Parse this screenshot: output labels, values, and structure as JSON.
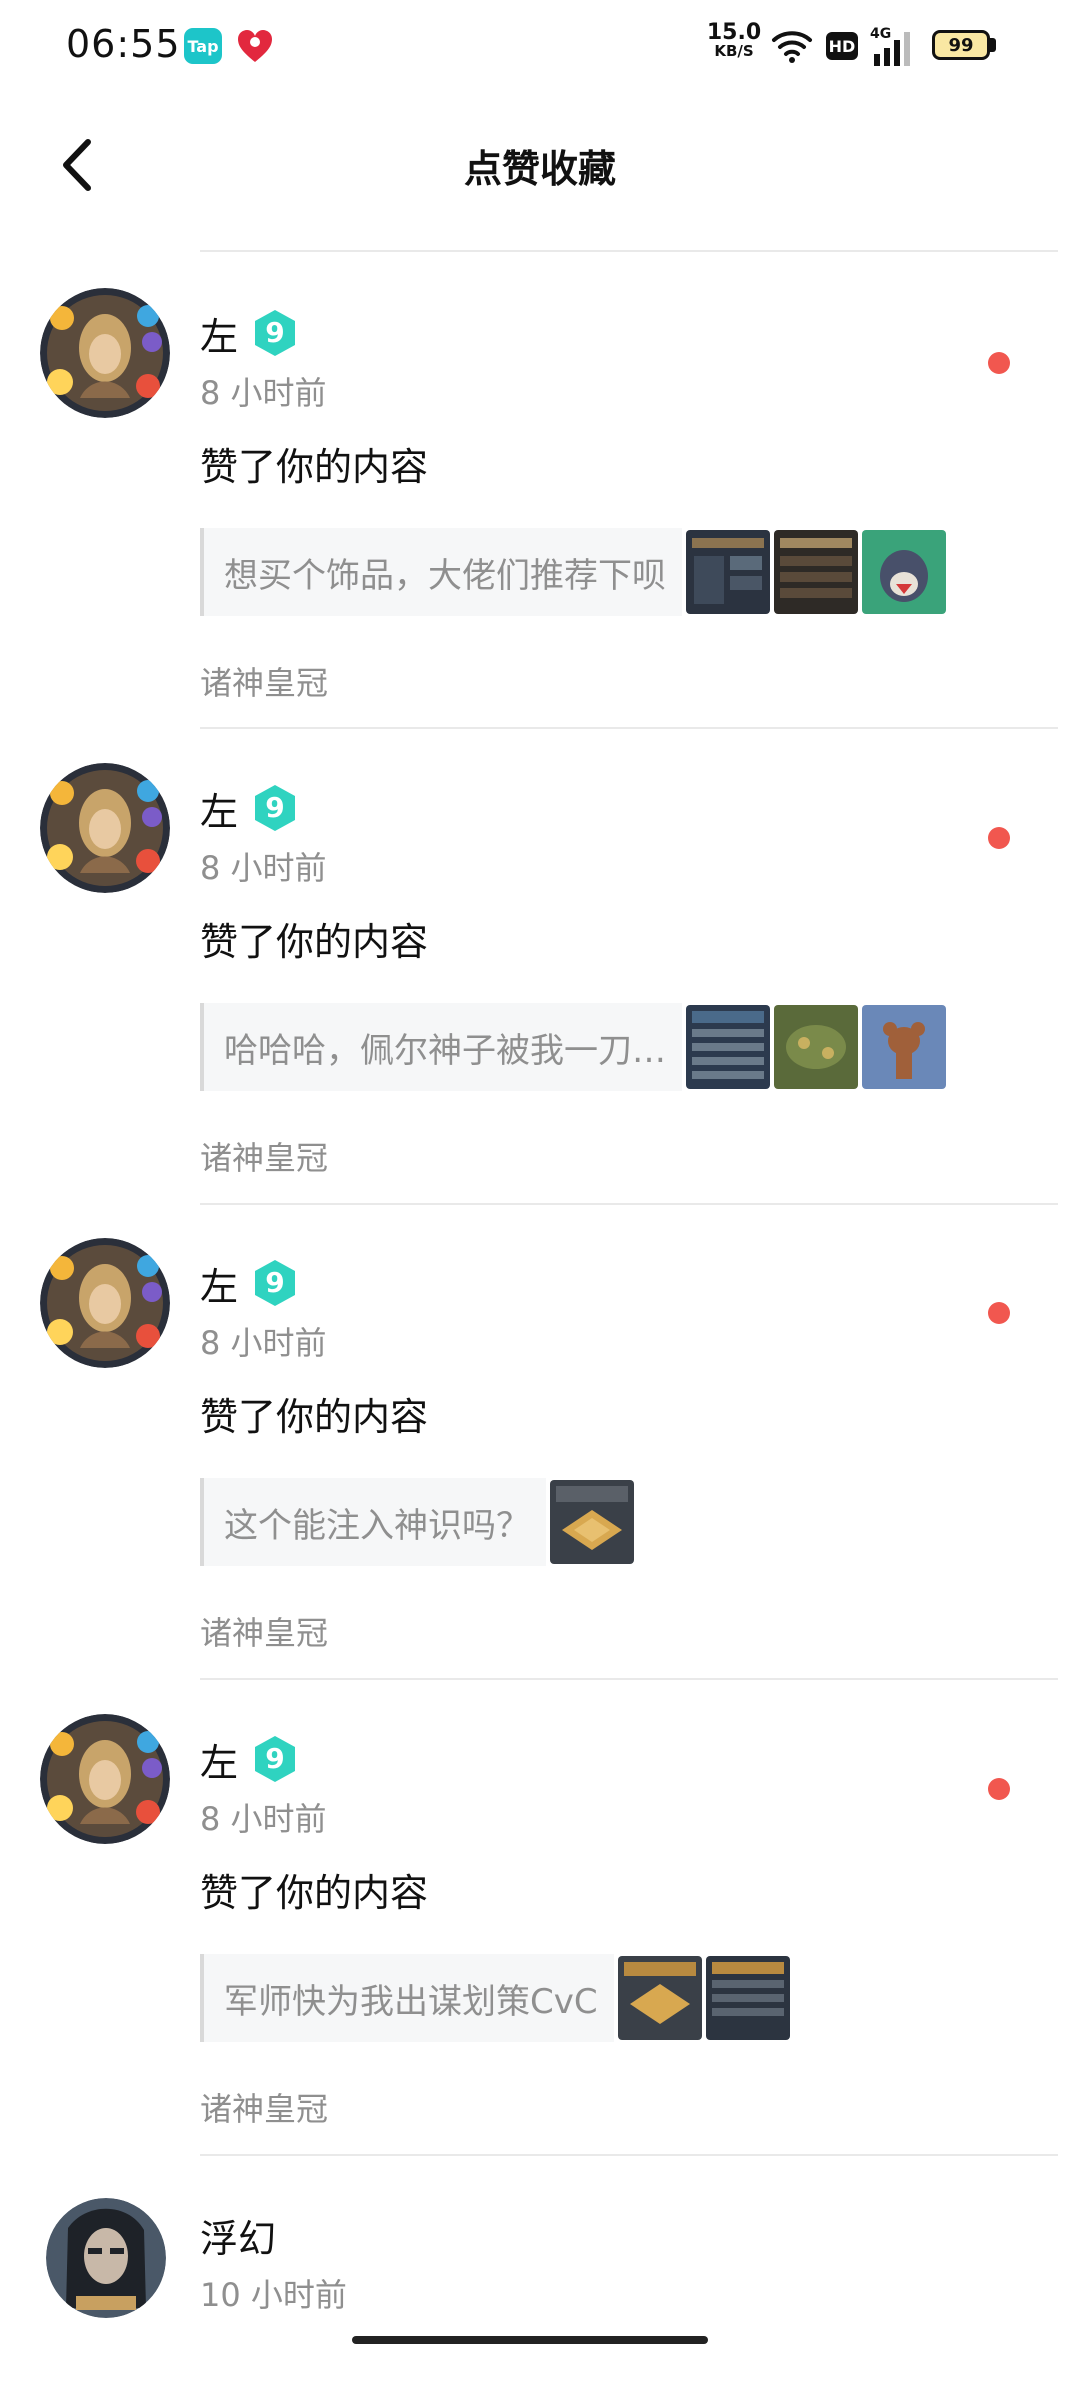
{
  "status_bar": {
    "time": "06:55",
    "tap_label": "Tap",
    "speed_value": "15.0",
    "speed_unit": "KB/S",
    "hd_label": "HD",
    "network_label": "4G",
    "battery": "99"
  },
  "header": {
    "title": "点赞收藏"
  },
  "items": [
    {
      "name": "左",
      "time": "8 小时前",
      "action": "赞了你的内容",
      "quote": "想买个饰品，大佬们推荐下呗",
      "group": "诸神皇冠"
    },
    {
      "name": "左",
      "time": "8 小时前",
      "action": "赞了你的内容",
      "quote": "哈哈哈，佩尔神子被我一刀…",
      "group": "诸神皇冠"
    },
    {
      "name": "左",
      "time": "8 小时前",
      "action": "赞了你的内容",
      "quote": "这个能注入神识吗？",
      "group": "诸神皇冠"
    },
    {
      "name": "左",
      "time": "8 小时前",
      "action": "赞了你的内容",
      "quote": "军师快为我出谋划策CvC",
      "group": "诸神皇冠"
    },
    {
      "name": "浮幻",
      "time": "10 小时前"
    }
  ],
  "colors": {
    "unread_dot": "#f1574f",
    "level_badge": "#2fd3c0",
    "secondary_text": "#8f8f8f"
  }
}
